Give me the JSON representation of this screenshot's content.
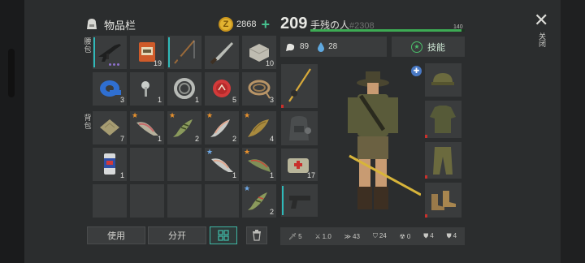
{
  "inventory": {
    "title": "物品栏",
    "coins": "2868",
    "add_symbol": "+",
    "hotbar_label": "腰包",
    "backpack_label": "背包"
  },
  "hotbar_row1": [
    {
      "name": "assault-rifle",
      "count": ""
    },
    {
      "name": "feed-bag",
      "count": "19"
    },
    {
      "name": "fishing-rod",
      "count": ""
    },
    {
      "name": "machete",
      "count": ""
    },
    {
      "name": "stone-block",
      "count": "10"
    }
  ],
  "hotbar_row2": [
    {
      "name": "duct-tape",
      "count": "3"
    },
    {
      "name": "bolt",
      "count": "1"
    },
    {
      "name": "bearing-ring",
      "count": "1"
    },
    {
      "name": "bottle-cap",
      "count": "5"
    },
    {
      "name": "rope-coil",
      "count": "3"
    }
  ],
  "backpack_rows": [
    [
      "7",
      "1",
      "2",
      "2",
      "4"
    ],
    [
      "1",
      "",
      "",
      "1",
      "1"
    ],
    [
      "",
      "",
      "",
      "",
      "2"
    ]
  ],
  "buttons": {
    "use": "使用",
    "split": "分开"
  },
  "player": {
    "level": "209",
    "name": "手残の人",
    "id": "#2308",
    "xp_label": "140",
    "xp_progress": 0.98,
    "hunger": "89",
    "thirst": "28",
    "skills_label": "技能"
  },
  "equipment": {
    "bag_count": "17"
  },
  "stats": {
    "damage": "5",
    "speed": "1.0",
    "run": "43",
    "armor": "24",
    "radiation": "0",
    "resist1": "4",
    "resist2": "4"
  },
  "close_label": "关闭",
  "close_symbol": "✕",
  "colors": {
    "accent_green": "#3dab54",
    "teal": "#3fb6a3",
    "coin": "#e2b331"
  }
}
